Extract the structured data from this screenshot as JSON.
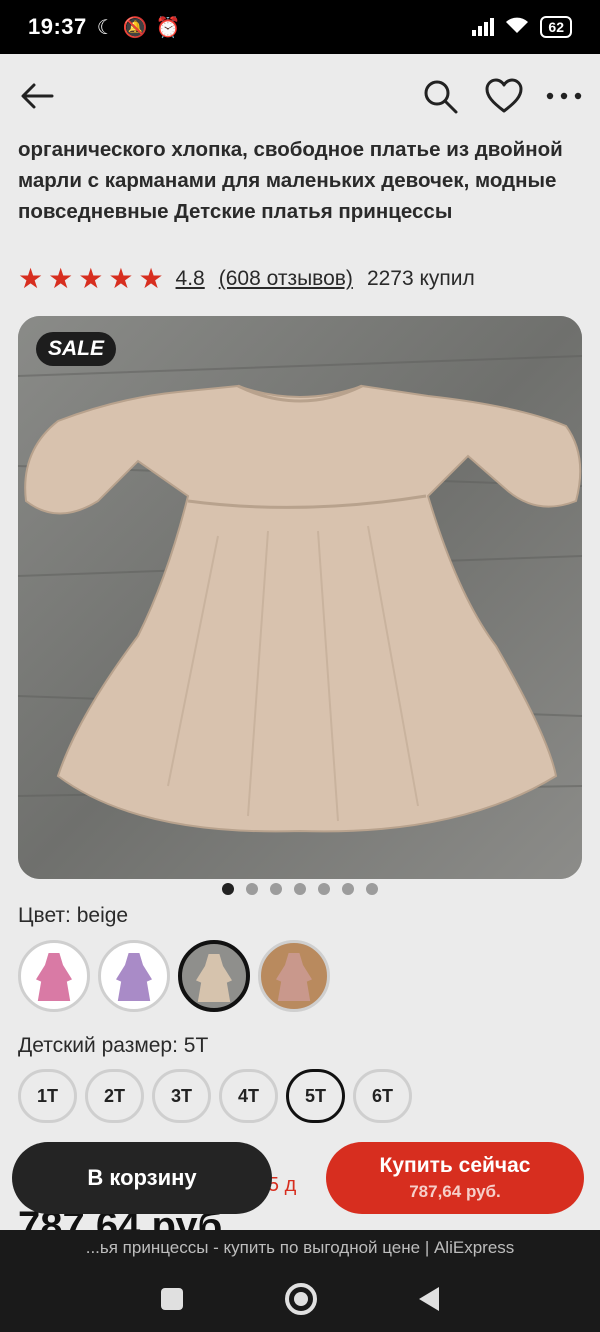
{
  "status_bar": {
    "time": "19:37",
    "battery": "62"
  },
  "product": {
    "title": "органического хлопка, свободное платье из двойной марли с карманами для маленьких девочек, модные повседневные Детские платья принцессы",
    "rating": "4.8",
    "reviews": "(608 отзывов)",
    "purchased": "2273 купил",
    "badge": "SALE",
    "image_count": 7,
    "active_image_index": 0
  },
  "color": {
    "label": "Цвет: beige",
    "options": [
      {
        "name": "pink",
        "color": "#d97aa5"
      },
      {
        "name": "purple",
        "color": "#a98bc7"
      },
      {
        "name": "beige",
        "color": "#d6c3ad"
      },
      {
        "name": "dusty-pink",
        "color": "#c9988c"
      }
    ],
    "selected_index": 2
  },
  "size": {
    "label": "Детский размер: 5T",
    "options": [
      "1T",
      "2T",
      "3T",
      "4T",
      "5T",
      "6T"
    ],
    "selected": "5T"
  },
  "background_text": {
    "delivery": "це 5 д",
    "price": "787,64 руб."
  },
  "actions": {
    "cart": "В корзину",
    "buy": "Купить сейчас",
    "buy_price": "787,64 руб."
  },
  "browser": {
    "url_text": "...ья принцессы - купить по выгодной цене | AliExpress"
  },
  "colors": {
    "accent": "#d72e1f",
    "dark_button": "#242424",
    "background": "#ebebeb"
  }
}
